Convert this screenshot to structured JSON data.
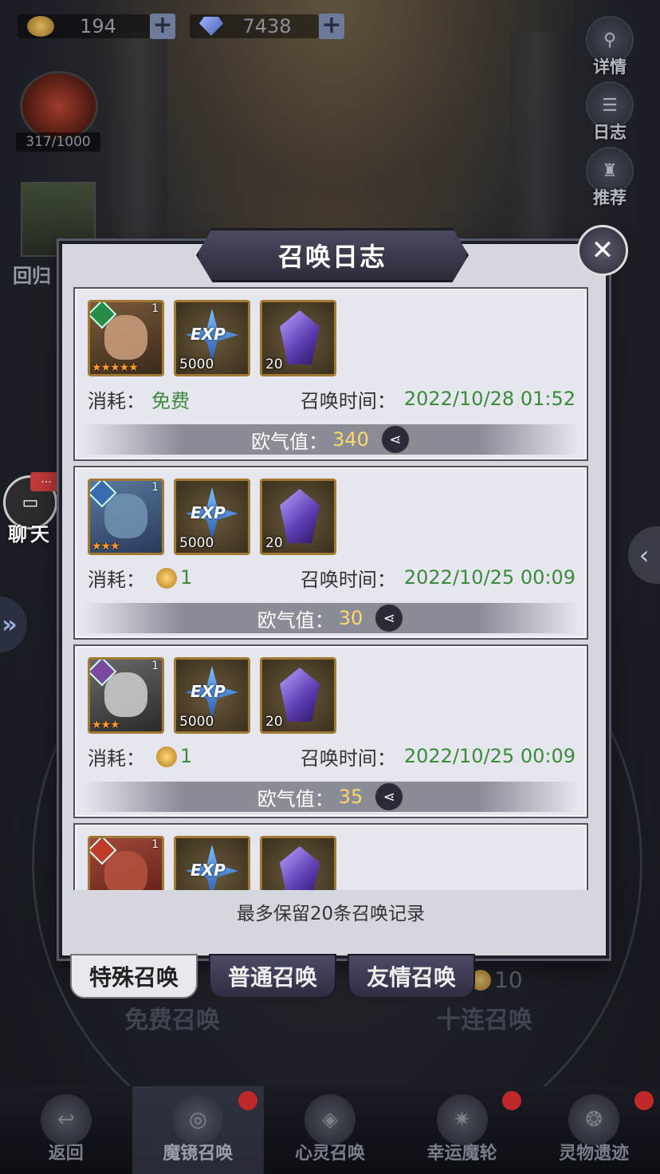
{
  "resources": {
    "gold": "194",
    "gems": "7438",
    "plus": "+"
  },
  "chest": {
    "count": "317/1000"
  },
  "left_panel": {
    "return_label": "回归"
  },
  "side_buttons": [
    {
      "label": "详情",
      "icon": "magnifier-icon"
    },
    {
      "label": "日志",
      "icon": "scroll-icon"
    },
    {
      "label": "推荐",
      "icon": "chess-icon"
    }
  ],
  "chat": {
    "label": "聊天",
    "badge": "..."
  },
  "modal": {
    "title": "召唤日志",
    "close": "✕",
    "footer": "最多保留20条召唤记录",
    "cost_label": "消耗：",
    "time_label": "召唤时间：",
    "luck_label": "欧气值：",
    "records": [
      {
        "hero_level": "1",
        "hero_stars": "★★★★★",
        "element": "nature",
        "exp_qty": "5000",
        "crystal_qty": "20",
        "cost_text": "免费",
        "cost_coin": false,
        "time": "2022/10/28 01:52",
        "luck": "340"
      },
      {
        "hero_level": "1",
        "hero_stars": "★★★",
        "element": "water",
        "exp_qty": "5000",
        "crystal_qty": "20",
        "cost_text": "1",
        "cost_coin": true,
        "time": "2022/10/25 00:09",
        "luck": "30"
      },
      {
        "hero_level": "1",
        "hero_stars": "★★★",
        "element": "shadow",
        "exp_qty": "5000",
        "crystal_qty": "20",
        "cost_text": "1",
        "cost_coin": true,
        "time": "2022/10/25 00:09",
        "luck": "35"
      },
      {
        "hero_level": "1",
        "element": "fire",
        "exp_text": "EXP"
      }
    ],
    "exp_text": "EXP"
  },
  "tabs": [
    {
      "label": "特殊召唤",
      "active": true
    },
    {
      "label": "普通召唤",
      "active": false
    },
    {
      "label": "友情召唤",
      "active": false
    }
  ],
  "behind": {
    "free_summon": "免费召唤",
    "ten_summon": "十连召唤",
    "ten_cost": "10"
  },
  "bottom_nav": [
    {
      "label": "返回",
      "icon": "return-icon",
      "active": false,
      "dot": false
    },
    {
      "label": "魔镜召唤",
      "icon": "mirror-icon",
      "active": true,
      "dot": true
    },
    {
      "label": "心灵召唤",
      "icon": "spirit-icon",
      "active": false,
      "dot": false
    },
    {
      "label": "幸运魔轮",
      "icon": "wheel-icon",
      "active": false,
      "dot": true
    },
    {
      "label": "灵物遗迹",
      "icon": "relic-icon",
      "active": false,
      "dot": true
    }
  ]
}
